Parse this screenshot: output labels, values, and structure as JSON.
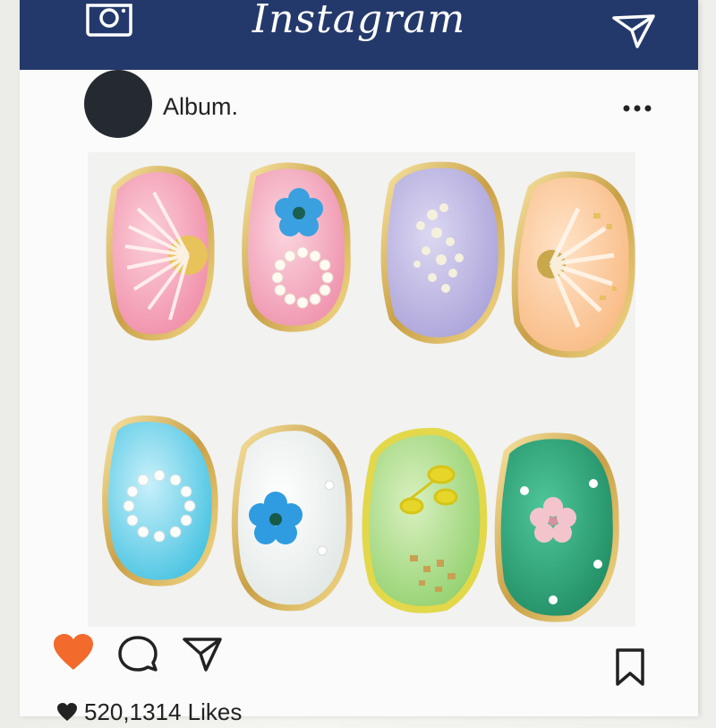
{
  "header": {
    "title": "Instagram",
    "icons": [
      "camera-icon",
      "send-icon"
    ],
    "bar_color": "#24396b"
  },
  "profile": {
    "username": "Album."
  },
  "post": {
    "image_alt": "Eight resin hair clips with gold frames and dried flowers",
    "pins_top_row": [
      "pink-daisy",
      "pink-blue-flower-pearl",
      "lavender-white-flowers",
      "peach-daisy-gold-flake"
    ],
    "pins_bottom_row": [
      "aqua-pearl-ring",
      "pearl-white-blue-flower",
      "green-yellow-flower-glitter",
      "teal-pink-blossom"
    ]
  },
  "actions": {
    "like_color": "#f26a2c",
    "icons": [
      "heart-icon",
      "comment-icon",
      "share-icon",
      "bookmark-icon"
    ]
  },
  "stats": {
    "likes_text": "520,1314  Likes"
  }
}
